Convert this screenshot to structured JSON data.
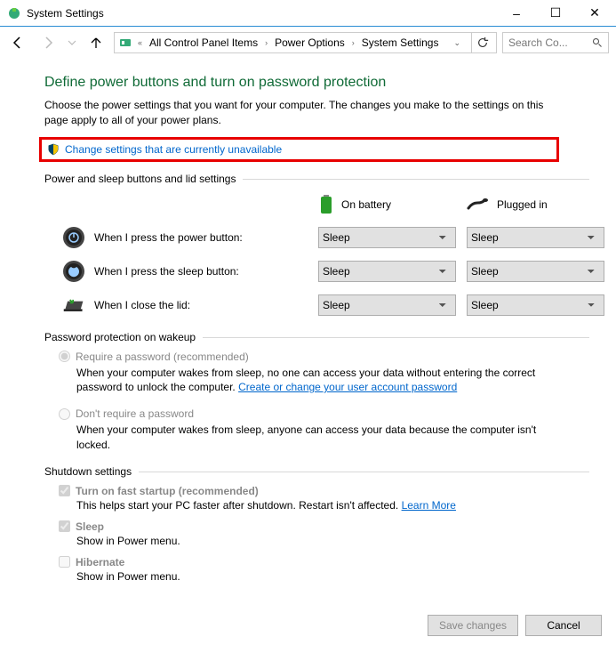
{
  "window": {
    "title": "System Settings",
    "minimize": "–",
    "maximize": "☐",
    "close": "✕"
  },
  "breadcrumb": {
    "items": [
      "All Control Panel Items",
      "Power Options",
      "System Settings"
    ]
  },
  "search": {
    "placeholder": "Search Co..."
  },
  "page": {
    "title": "Define power buttons and turn on password protection",
    "sub": "Choose the power settings that you want for your computer. The changes you make to the settings on this page apply to all of your power plans.",
    "change_link": "Change settings that are currently unavailable"
  },
  "power": {
    "section": "Power and sleep buttons and lid settings",
    "col_battery": "On battery",
    "col_plugged": "Plugged in",
    "rows": [
      {
        "label": "When I press the power button:",
        "battery": "Sleep",
        "plugged": "Sleep"
      },
      {
        "label": "When I press the sleep button:",
        "battery": "Sleep",
        "plugged": "Sleep"
      },
      {
        "label": "When I close the lid:",
        "battery": "Sleep",
        "plugged": "Sleep"
      }
    ]
  },
  "password": {
    "section": "Password protection on wakeup",
    "opt1_label": "Require a password (recommended)",
    "opt1_desc_a": "When your computer wakes from sleep, no one can access your data without entering the correct password to unlock the computer. ",
    "opt1_link": "Create or change your user account password",
    "opt2_label": "Don't require a password",
    "opt2_desc": "When your computer wakes from sleep, anyone can access your data because the computer isn't locked."
  },
  "shutdown": {
    "section": "Shutdown settings",
    "fast_label": "Turn on fast startup (recommended)",
    "fast_desc_a": "This helps start your PC faster after shutdown. Restart isn't affected. ",
    "fast_link": "Learn More",
    "sleep_label": "Sleep",
    "sleep_desc": "Show in Power menu.",
    "hibernate_label": "Hibernate",
    "hibernate_desc": "Show in Power menu."
  },
  "footer": {
    "save": "Save changes",
    "cancel": "Cancel"
  }
}
